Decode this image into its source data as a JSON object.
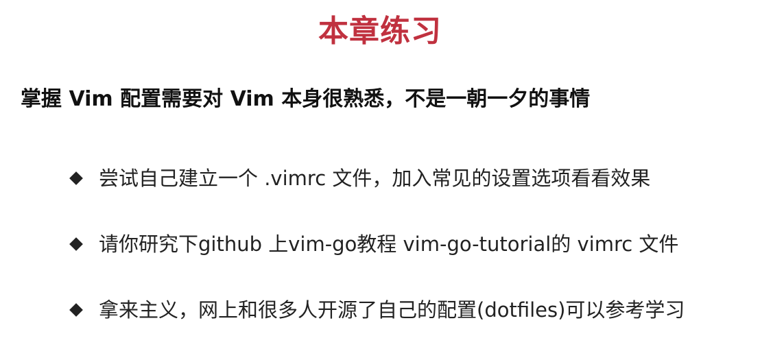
{
  "slide": {
    "title": "本章练习",
    "subtitle": "掌握 Vim 配置需要对 Vim 本身很熟悉，不是一朝一夕的事情",
    "bullets": [
      {
        "icon": "diamond-bullet-icon",
        "text": "尝试自己建立一个 .vimrc 文件，加入常见的设置选项看看效果"
      },
      {
        "icon": "diamond-bullet-icon",
        "text": "请你研究下github 上vim-go教程 vim-go-tutorial的 vimrc 文件"
      },
      {
        "icon": "diamond-bullet-icon",
        "text": "拿来主义，网上和很多人开源了自己的配置(dotfiles)可以参考学习"
      }
    ],
    "colors": {
      "title": "#c0313f",
      "text": "#222222",
      "bullet": "#222222"
    }
  }
}
